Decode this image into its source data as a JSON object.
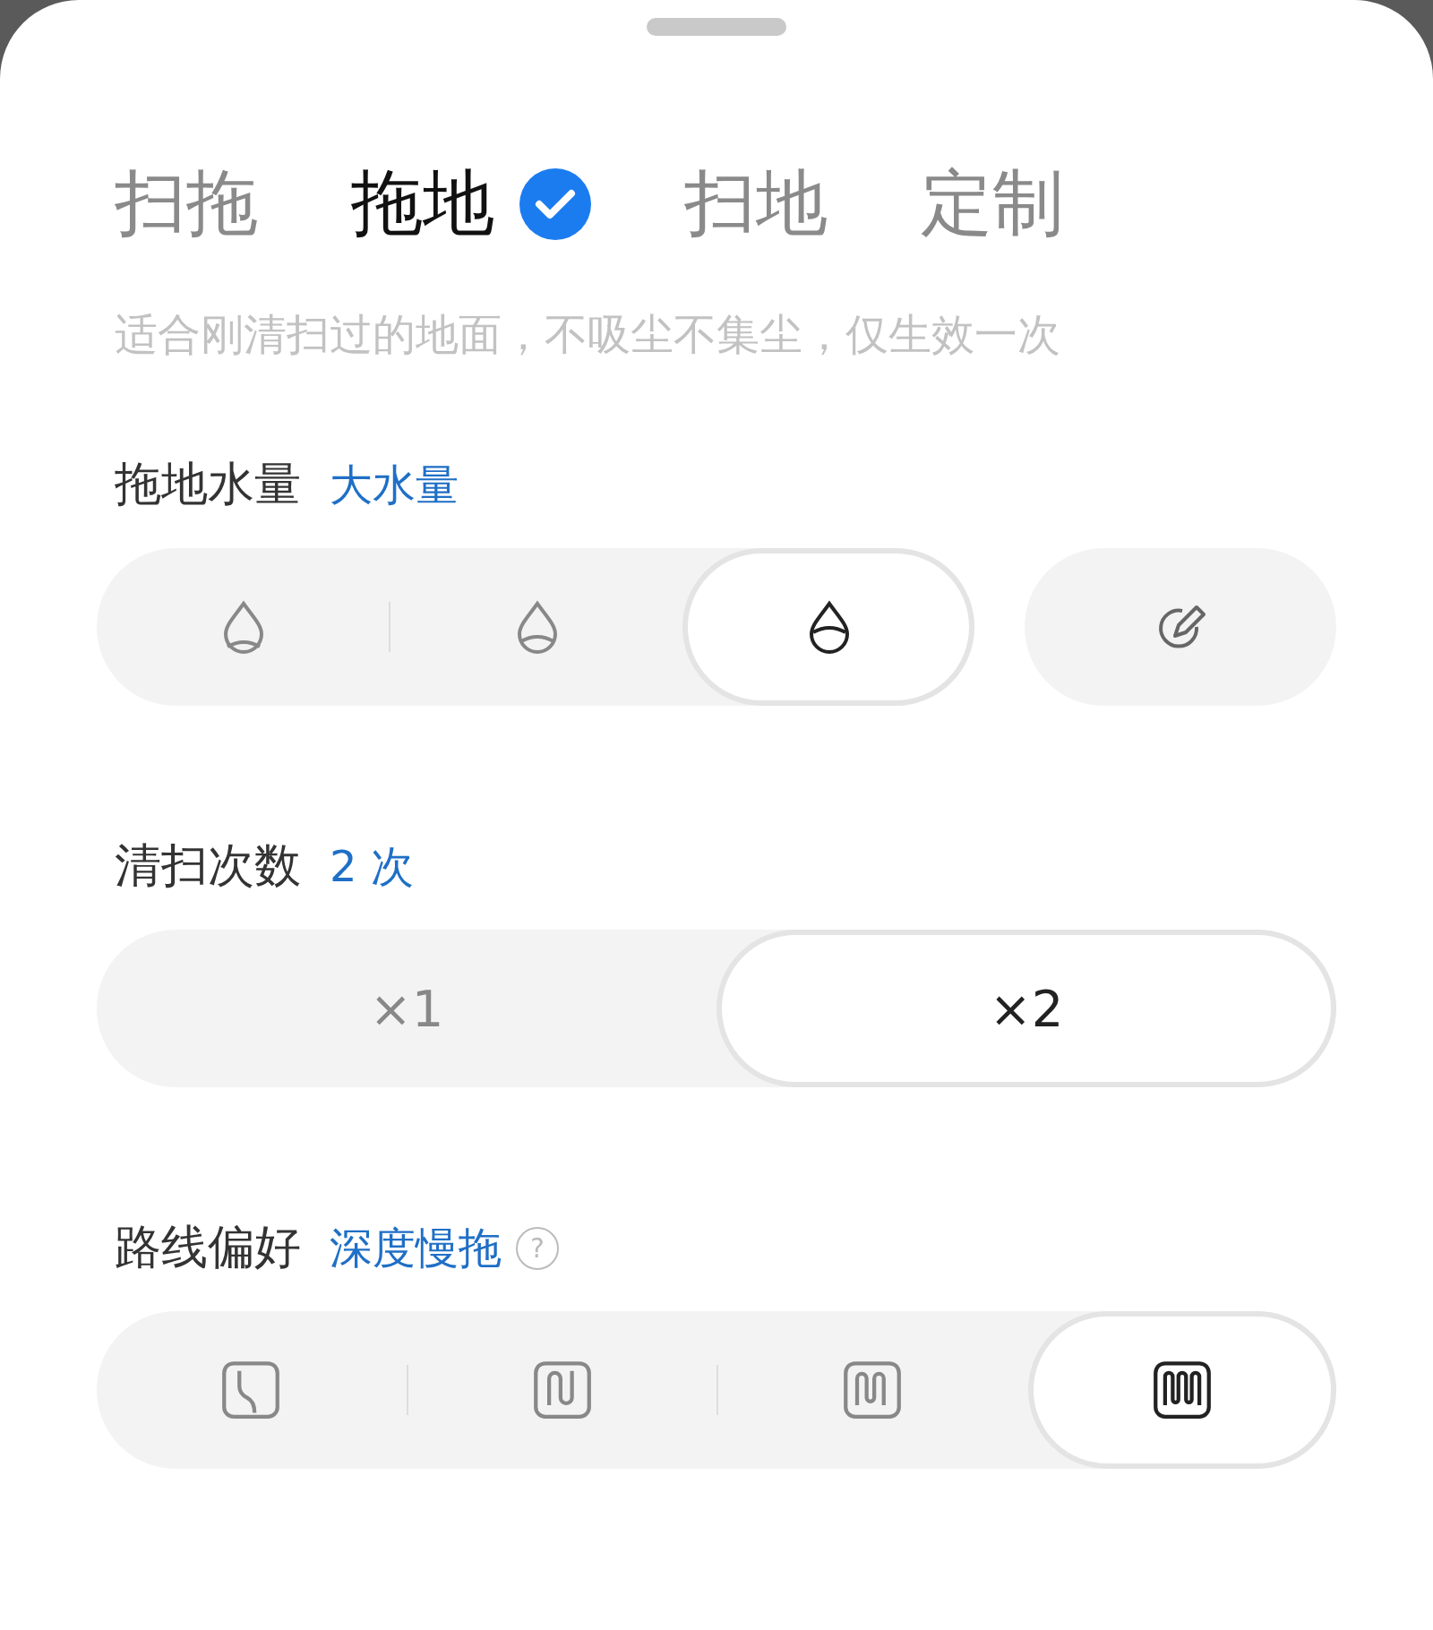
{
  "tabs": [
    {
      "label": "扫拖",
      "selected": false
    },
    {
      "label": "拖地",
      "selected": true
    },
    {
      "label": "扫地",
      "selected": false
    },
    {
      "label": "定制",
      "selected": false
    }
  ],
  "description": "适合刚清扫过的地面，不吸尘不集尘，仅生效一次",
  "sections": [
    {
      "kind": "water",
      "label": "拖地水量",
      "value": "大水量",
      "options": [
        {
          "selected": false
        },
        {
          "selected": false
        },
        {
          "selected": true
        }
      ],
      "custom": {
        "selected": false
      }
    },
    {
      "kind": "count",
      "label": "清扫次数",
      "value": "2 次",
      "options": [
        {
          "label": "×1",
          "selected": false
        },
        {
          "label": "×2",
          "selected": true
        }
      ]
    },
    {
      "kind": "route",
      "label": "路线偏好",
      "value": "深度慢拖",
      "help": "?",
      "options": [
        {
          "selected": false
        },
        {
          "selected": false
        },
        {
          "selected": false
        },
        {
          "selected": true
        }
      ]
    }
  ]
}
